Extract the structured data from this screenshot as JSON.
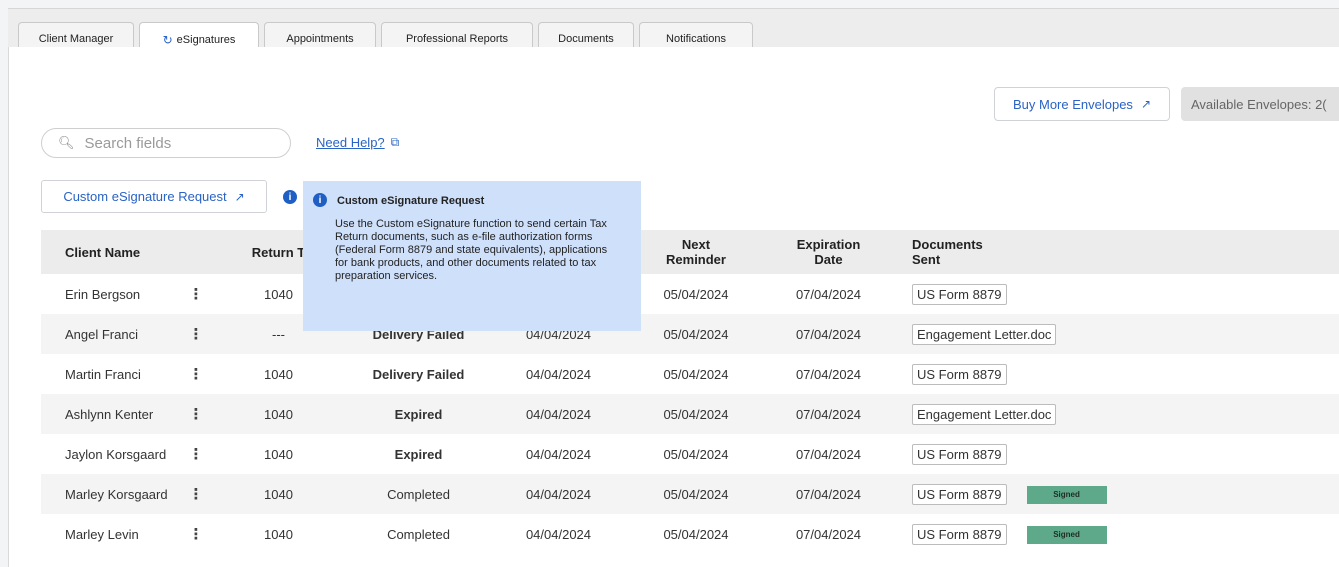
{
  "tabs": [
    {
      "label": "Client Manager"
    },
    {
      "label": "eSignatures",
      "icon": "refresh-icon",
      "active": true
    },
    {
      "label": "Appointments"
    },
    {
      "label": "Professional Reports"
    },
    {
      "label": "Documents"
    },
    {
      "label": "Notifications"
    }
  ],
  "toolbar": {
    "buy_label": "Buy More Envelopes",
    "available_label": "Available Envelopes: 2("
  },
  "search": {
    "placeholder": "Search fields"
  },
  "help": {
    "label": "Need Help?"
  },
  "custom_request": {
    "label": "Custom eSignature Request"
  },
  "tooltip": {
    "title": "Custom eSignature Request",
    "body": "Use the Custom eSignature function to send certain Tax Return documents, such as e-file authorization forms (Federal Form 8879 and state equivalents), applications for bank products, and other documents related to tax preparation services."
  },
  "table": {
    "headers": {
      "client_name": "Client Name",
      "return_type": "Return T",
      "status": "",
      "date_sent": "",
      "next_reminder": "Next Reminder",
      "expiration_date": "Expiration Date",
      "documents_sent": "Documents Sent"
    },
    "rows": [
      {
        "name": "Erin Bergson",
        "type": "1040",
        "status": "",
        "status_red": false,
        "sent": "",
        "next": "05/04/2024",
        "exp": "07/04/2024",
        "doc": "US Form 8879",
        "signed": ""
      },
      {
        "name": "Angel Franci",
        "type": "---",
        "status": "Delivery Failed",
        "status_red": true,
        "sent": "04/04/2024",
        "next": "05/04/2024",
        "exp": "07/04/2024",
        "doc": "Engagement Letter.doc",
        "signed": ""
      },
      {
        "name": "Martin Franci",
        "type": "1040",
        "status": "Delivery Failed",
        "status_red": true,
        "sent": "04/04/2024",
        "next": "05/04/2024",
        "exp": "07/04/2024",
        "doc": "US Form 8879",
        "signed": ""
      },
      {
        "name": "Ashlynn Kenter",
        "type": "1040",
        "status": "Expired",
        "status_red": true,
        "sent": "04/04/2024",
        "next": "05/04/2024",
        "exp": "07/04/2024",
        "doc": "Engagement Letter.doc",
        "signed": ""
      },
      {
        "name": "Jaylon Korsgaard",
        "type": "1040",
        "status": "Expired",
        "status_red": true,
        "sent": "04/04/2024",
        "next": "05/04/2024",
        "exp": "07/04/2024",
        "doc": "US Form 8879",
        "signed": ""
      },
      {
        "name": "Marley Korsgaard",
        "type": "1040",
        "status": "Completed",
        "status_red": false,
        "sent": "04/04/2024",
        "next": "05/04/2024",
        "exp": "07/04/2024",
        "doc": "US Form 8879",
        "signed": "Signed"
      },
      {
        "name": "Marley Levin",
        "type": "1040",
        "status": "Completed",
        "status_red": false,
        "sent": "04/04/2024",
        "next": "05/04/2024",
        "exp": "07/04/2024",
        "doc": "US Form 8879",
        "signed": "Signed"
      }
    ]
  },
  "colors": {
    "accent": "#2a63c4",
    "error": "#e3423a",
    "signed": "#5ea98a",
    "tooltip_bg": "#cfe0fb"
  }
}
